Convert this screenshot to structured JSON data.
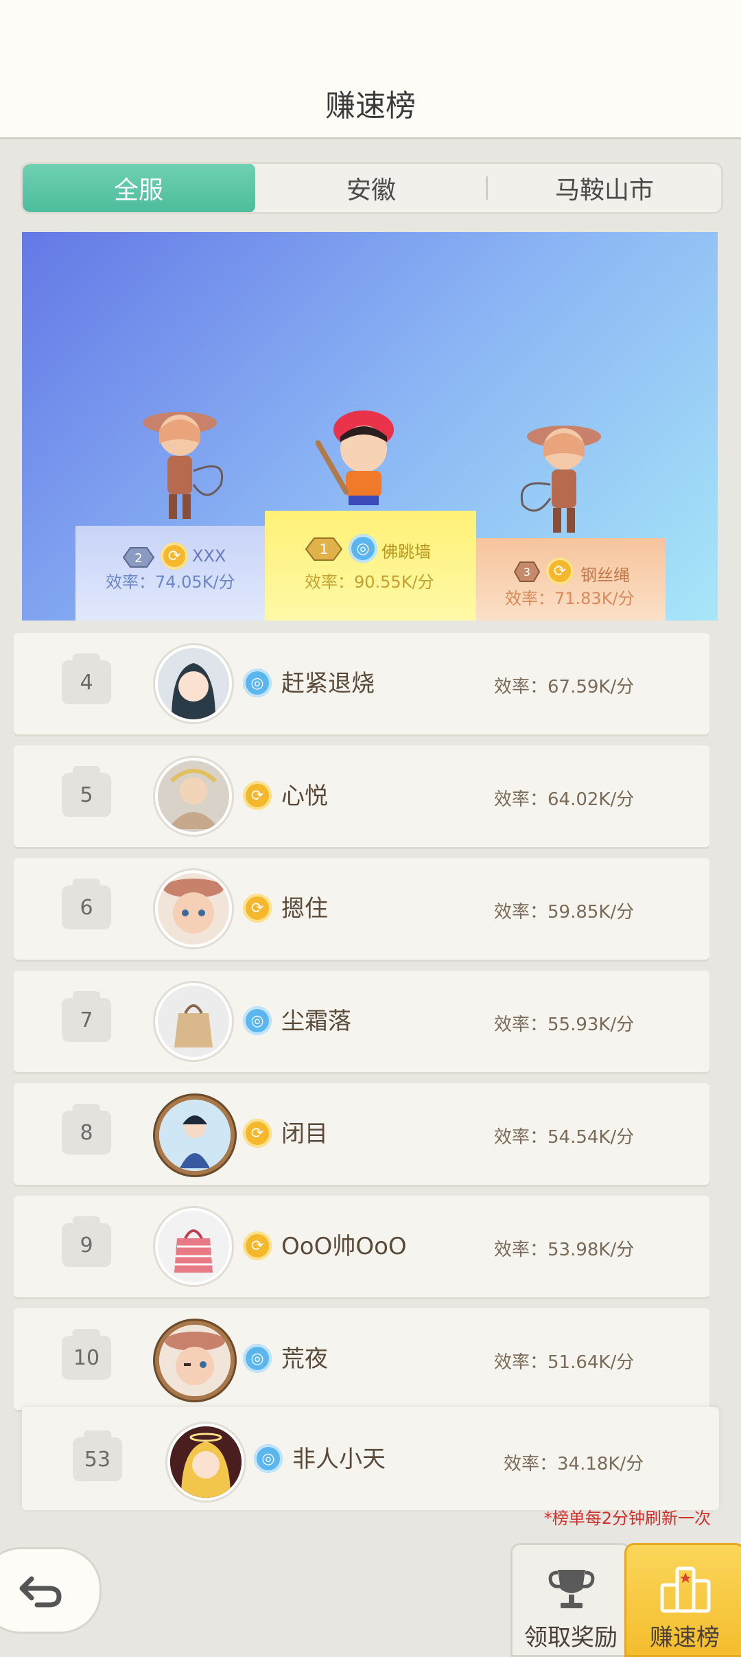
{
  "header": {
    "title": "赚速榜"
  },
  "tabs": [
    {
      "label": "全服",
      "active": true
    },
    {
      "label": "安徽",
      "active": false
    },
    {
      "label": "马鞍山市",
      "active": false
    }
  ],
  "podium": [
    {
      "rank": "2",
      "name": "XXX",
      "efficiency": "效率：74.05K/分",
      "badge": "gold"
    },
    {
      "rank": "1",
      "name": "佛跳墙",
      "efficiency": "效率：90.55K/分",
      "badge": "blue"
    },
    {
      "rank": "3",
      "name": "钢丝绳",
      "efficiency": "效率：71.83K/分",
      "badge": "gold"
    }
  ],
  "rows": [
    {
      "rank": "4",
      "name": "赶紧退烧",
      "efficiency": "效率：67.59K/分",
      "badge": "blue"
    },
    {
      "rank": "5",
      "name": "心悦",
      "efficiency": "效率：64.02K/分",
      "badge": "gold"
    },
    {
      "rank": "6",
      "name": "摁住",
      "efficiency": "效率：59.85K/分",
      "badge": "gold"
    },
    {
      "rank": "7",
      "name": "尘霜落",
      "efficiency": "效率：55.93K/分",
      "badge": "blue"
    },
    {
      "rank": "8",
      "name": "闭目",
      "efficiency": "效率：54.54K/分",
      "badge": "gold"
    },
    {
      "rank": "9",
      "name": "OoO帅OoO",
      "efficiency": "效率：53.98K/分",
      "badge": "gold"
    },
    {
      "rank": "10",
      "name": "荒夜",
      "efficiency": "效率：51.64K/分",
      "badge": "blue"
    }
  ],
  "self": {
    "rank": "53",
    "name": "非人小天",
    "efficiency": "效率：34.18K/分",
    "badge": "blue"
  },
  "note": "*榜单每2分钟刷新一次",
  "nav": {
    "reward_label": "领取奖励",
    "rank_label": "赚速榜"
  },
  "icons": {
    "back": "back-arrow-icon",
    "trophy": "trophy-icon",
    "podium": "podium-icon"
  },
  "colors": {
    "active_tab": "#4cbd9c",
    "note": "#d0302c",
    "rank_nav": "#f7c53c"
  }
}
